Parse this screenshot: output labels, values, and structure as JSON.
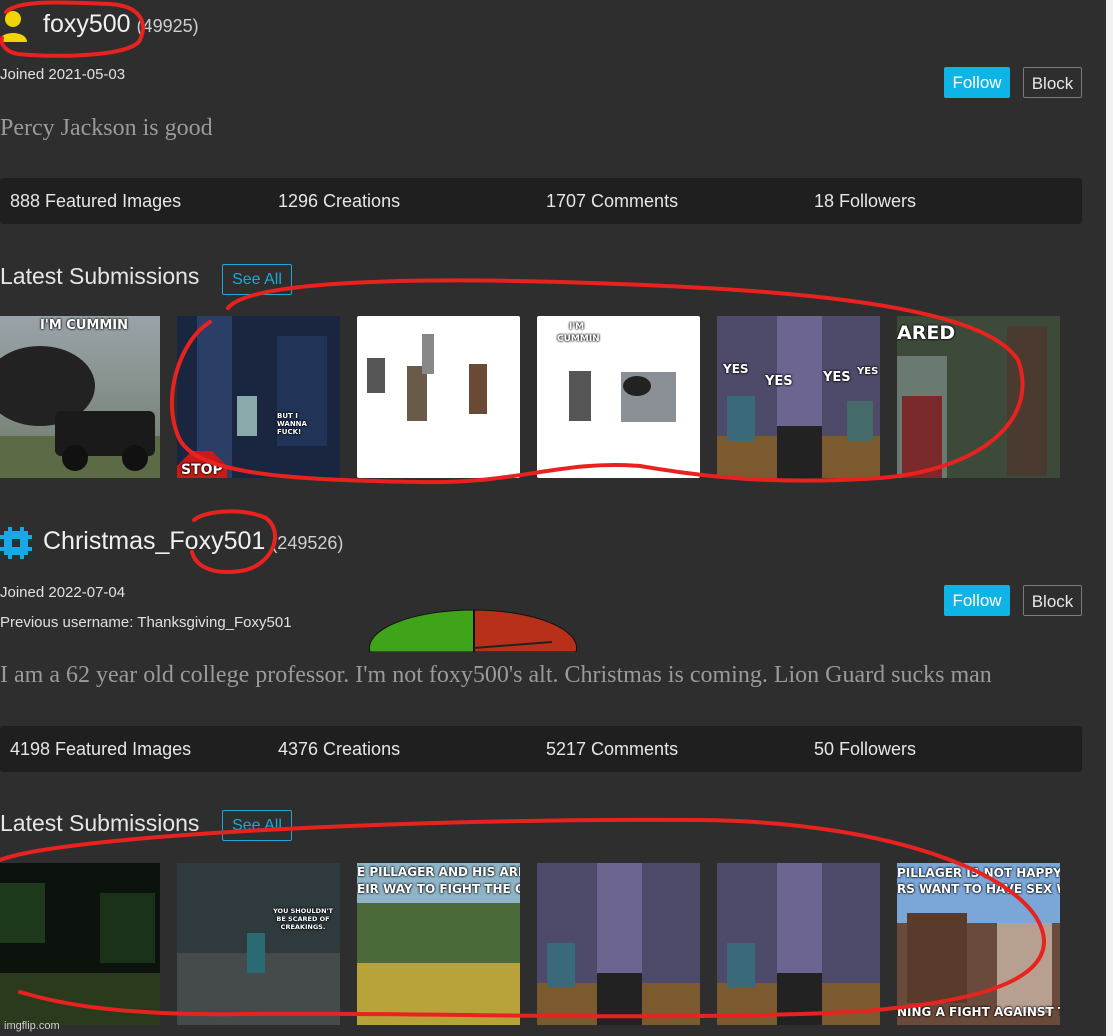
{
  "users": [
    {
      "username": "foxy500",
      "points": "(49925)",
      "joined": "Joined 2021-05-03",
      "previous_username": "",
      "bio": "Percy Jackson is good",
      "follow_label": "Follow",
      "block_label": "Block",
      "stats": [
        "888 Featured Images",
        "1296 Creations",
        "1707 Comments",
        "18 Followers"
      ],
      "section_title": "Latest Submissions",
      "see_all_label": "See All",
      "thumb_captions": [
        [
          "I'M CUMMIN"
        ],
        [
          "BUT I WANNA FUCK!",
          "STOP"
        ],
        [
          ""
        ],
        [
          "I'M",
          "CUMMIN"
        ],
        [
          "YES",
          "YES",
          "YES",
          "YES"
        ],
        [
          "ARED"
        ]
      ]
    },
    {
      "username": "Christmas_Foxy501",
      "points": "(249526)",
      "joined": "Joined 2022-07-04",
      "previous_username": "Previous username: Thanksgiving_Foxy501",
      "bio": "I am a 62 year old college professor. I'm not foxy500's alt. Christmas is coming. Lion Guard sucks man",
      "follow_label": "Follow",
      "block_label": "Block",
      "stats": [
        "4198 Featured Images",
        "4376 Creations",
        "5217 Comments",
        "50 Followers"
      ],
      "section_title": "Latest Submissions",
      "see_all_label": "See All",
      "thumb_captions": [
        [
          ""
        ],
        [
          "YOU SHOULDN'T BE SCARED OF CREAKINGS."
        ],
        [
          "E PILLAGER AND HIS ARMY",
          "EIR WAY TO FIGHT THE CREA"
        ],
        [
          ""
        ],
        [
          ""
        ],
        [
          "PILLAGER IS NOT HAPPY ABOUT",
          "RS WANT TO HAVE SEX WITH C",
          "NING A FIGHT AGAINST THE C"
        ]
      ]
    }
  ],
  "watermark": "imgflip.com",
  "colors": {
    "accent": "#0fb4e6",
    "background": "#2e2e2e",
    "stats_bar": "#1f1f1f",
    "annotation": "#e8231f"
  },
  "icons": {
    "user_avatar": "user-silhouette-icon",
    "pixel_avatar": "pixel-badge-icon"
  }
}
